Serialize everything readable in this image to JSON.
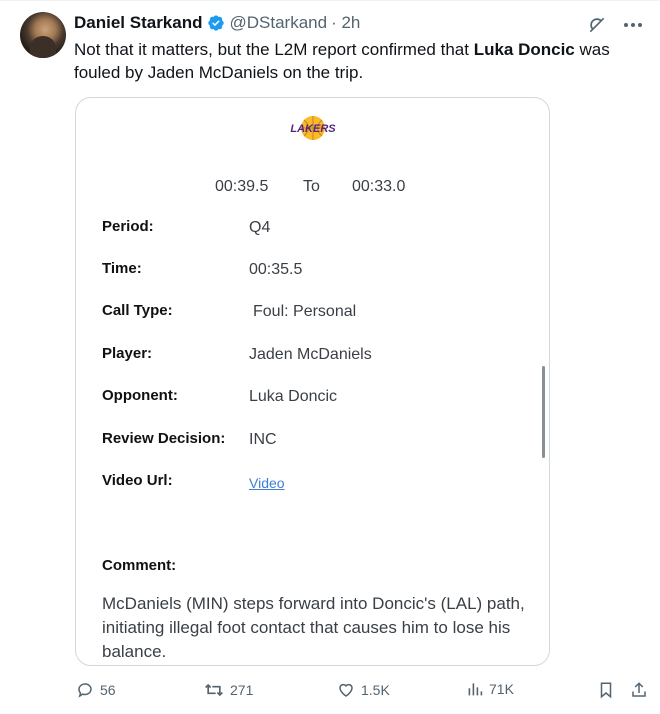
{
  "author": {
    "name": "Daniel Starkand",
    "handle": "@DStarkand",
    "time": "· 2h"
  },
  "tweet": {
    "text_before": "Not that it matters, but the L2M report confirmed that ",
    "bold_name": "Luka Doncic",
    "text_after": " was fouled by Jaden McDaniels on the trip."
  },
  "card": {
    "logo_text": "LAKERS",
    "range_start": "00:39.5",
    "range_to": "To",
    "range_end": "00:33.0",
    "rows": [
      {
        "label": "Period:",
        "value": "Q4"
      },
      {
        "label": "Time:",
        "value": "00:35.5"
      },
      {
        "label": "Call Type:",
        "value": "Foul: Personal"
      },
      {
        "label": "Player:",
        "value": "Jaden McDaniels"
      },
      {
        "label": "Opponent:",
        "value": "Luka Doncic"
      },
      {
        "label": "Review Decision:",
        "value": "INC"
      },
      {
        "label": "Video Url:",
        "value": "Video"
      }
    ],
    "comment_label": "Comment:",
    "comment_text": "McDaniels (MIN) steps forward into Doncic's (LAL) path, initiating illegal foot contact that causes him to lose his balance."
  },
  "actions": {
    "replies": "56",
    "reposts": "271",
    "likes": "1.5K",
    "views": "71K"
  },
  "icons": {
    "verified": "verified-badge-icon",
    "grok": "grok-icon",
    "more": "more-icon",
    "reply": "reply-icon",
    "repost": "repost-icon",
    "like": "heart-icon",
    "views": "views-icon",
    "bookmark": "bookmark-icon",
    "share": "share-icon"
  },
  "colors": {
    "verified": "#1d9bf0",
    "link": "#3d7fd6",
    "lakers_purple": "#552583",
    "lakers_gold": "#fdb927"
  }
}
